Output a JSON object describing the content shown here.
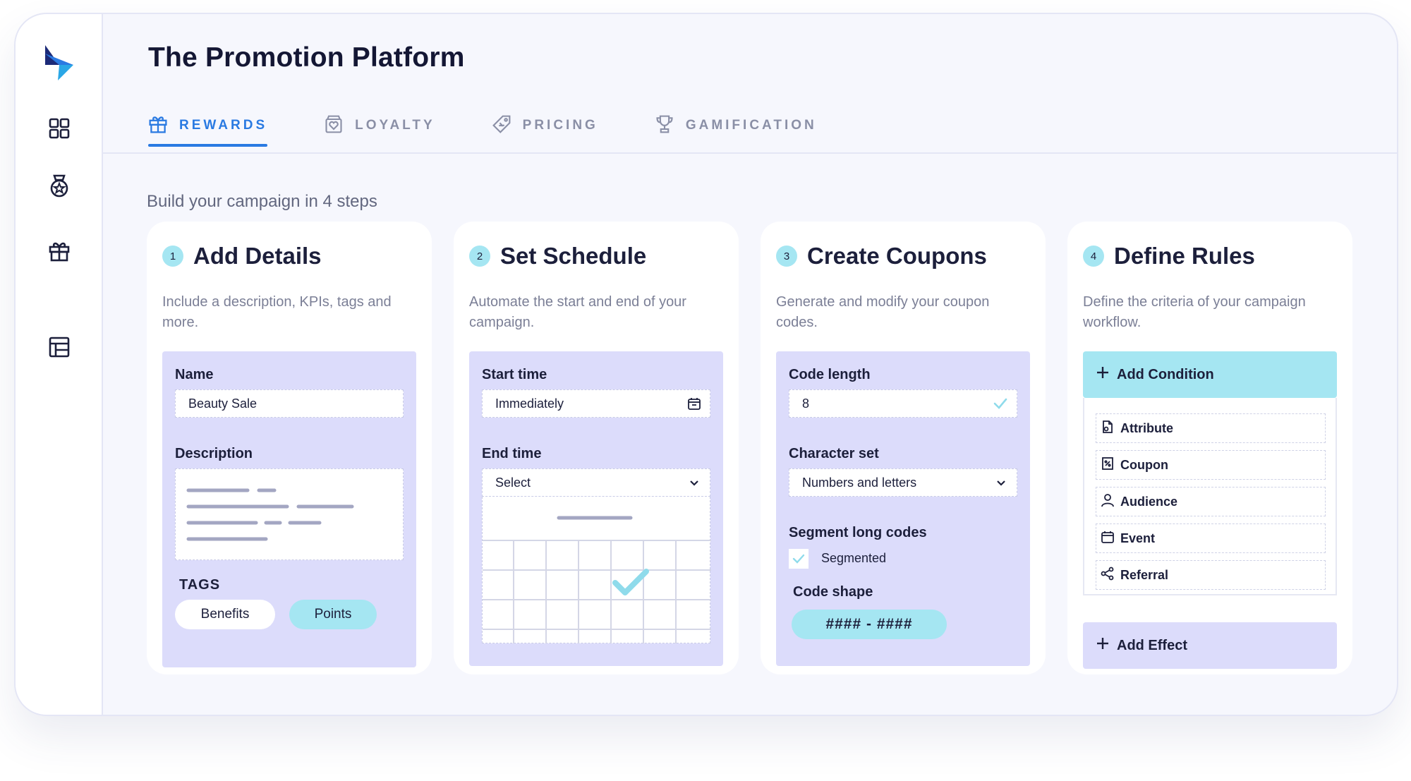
{
  "app": {
    "title": "The Promotion Platform"
  },
  "sidebar": {
    "items": [
      {
        "icon": "dashboard-grid-icon"
      },
      {
        "icon": "medal-icon"
      },
      {
        "icon": "gift-icon"
      },
      {
        "icon": "layout-table-icon"
      }
    ]
  },
  "tabs": [
    {
      "label": "REWARDS",
      "icon": "gift-icon",
      "active": true
    },
    {
      "label": "LOYALTY",
      "icon": "loyalty-box-icon",
      "active": false
    },
    {
      "label": "PRICING",
      "icon": "price-tag-icon",
      "active": false
    },
    {
      "label": "GAMIFICATION",
      "icon": "trophy-icon",
      "active": false
    }
  ],
  "subtitle": "Build your campaign in 4 steps",
  "steps": [
    {
      "number": "1",
      "title": "Add Details",
      "description": "Include a description, KPIs, tags and more.",
      "name_label": "Name",
      "name_value": "Beauty Sale",
      "description_label": "Description",
      "tags_label": "TAGS",
      "tags": [
        "Benefits",
        "Points"
      ]
    },
    {
      "number": "2",
      "title": "Set Schedule",
      "description": "Automate the start and end of your campaign.",
      "start_label": "Start time",
      "start_value": "Immediately",
      "end_label": "End time",
      "end_value": "Select"
    },
    {
      "number": "3",
      "title": "Create Coupons",
      "description": "Generate and modify your coupon codes.",
      "length_label": "Code length",
      "length_value": "8",
      "charset_label": "Character set",
      "charset_value": "Numbers and letters",
      "segment_label": "Segment long codes",
      "segment_option": "Segmented",
      "segment_checked": true,
      "shape_label": "Code shape",
      "shape_value": "#### - ####"
    },
    {
      "number": "4",
      "title": "Define Rules",
      "description": "Define the criteria of your campaign workflow.",
      "add_condition": "Add Condition",
      "conditions": [
        {
          "label": "Attribute",
          "icon": "attribute-icon"
        },
        {
          "label": "Coupon",
          "icon": "coupon-icon"
        },
        {
          "label": "Audience",
          "icon": "user-icon"
        },
        {
          "label": "Event",
          "icon": "calendar-icon"
        },
        {
          "label": "Referral",
          "icon": "share-icon"
        }
      ],
      "add_effect": "Add Effect"
    }
  ],
  "colors": {
    "accent": "#2a7ae2",
    "panel": "#dcdcfb",
    "cyan": "#a5e6f2",
    "text": "#1c1f3b"
  }
}
